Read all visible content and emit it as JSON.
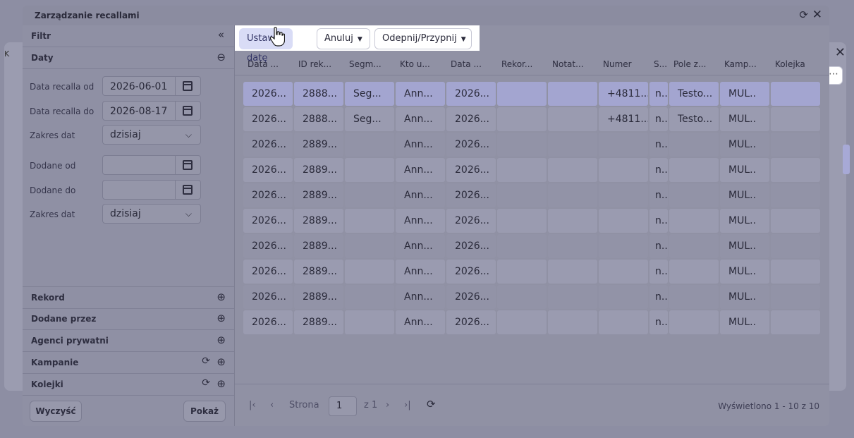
{
  "modal": {
    "title": "Zarządzanie recallami"
  },
  "filter": {
    "header": "Filtr",
    "section_dates": "Daty",
    "rows": {
      "recall_from_label": "Data recalla od",
      "recall_from_value": "2026-06-01",
      "recall_to_label": "Data recalla do",
      "recall_to_value": "2026-08-17",
      "range1_label": "Zakres dat",
      "range1_value": "dzisiaj",
      "added_from_label": "Dodane od",
      "added_from_value": "",
      "added_to_label": "Dodane do",
      "added_to_value": "",
      "range2_label": "Zakres dat",
      "range2_value": "dzisiaj"
    },
    "sections": [
      "Rekord",
      "Dodane przez",
      "Agenci prywatni",
      "Kampanie",
      "Kolejki"
    ],
    "clear_label": "Wyczyść",
    "show_label": "Pokaż"
  },
  "toolbar": {
    "set_date_label": "Ustaw datę",
    "cancel_label": "Anuluj",
    "pin_label": "Odepnij/Przypnij"
  },
  "grid": {
    "columns": [
      "Data ...",
      "ID rek...",
      "Segm...",
      "Kto u...",
      "Data ...",
      "Rekor...",
      "Notat...",
      "Numer",
      "S...",
      "Pole z...",
      "Kamp...",
      "Kolejka"
    ],
    "rows": [
      [
        "2026...",
        "2888...",
        "Seg...",
        "Ann...",
        "2026...",
        "",
        "",
        "+4811...",
        "n..",
        "Testo...",
        "MUL..",
        ""
      ],
      [
        "2026...",
        "2888...",
        "Seg...",
        "Ann...",
        "2026...",
        "",
        "",
        "+4811...",
        "n..",
        "Testo...",
        "MUL..",
        ""
      ],
      [
        "2026...",
        "2889...",
        "",
        "Ann...",
        "2026...",
        "",
        "",
        "",
        "n..",
        "",
        "MUL..",
        ""
      ],
      [
        "2026...",
        "2889...",
        "",
        "Ann...",
        "2026...",
        "",
        "",
        "",
        "n..",
        "",
        "MUL..",
        ""
      ],
      [
        "2026...",
        "2889...",
        "",
        "Ann...",
        "2026...",
        "",
        "",
        "",
        "n..",
        "",
        "MUL..",
        ""
      ],
      [
        "2026...",
        "2889...",
        "",
        "Ann...",
        "2026...",
        "",
        "",
        "",
        "n..",
        "",
        "MUL..",
        ""
      ],
      [
        "2026...",
        "2889...",
        "",
        "Ann...",
        "2026...",
        "",
        "",
        "",
        "n..",
        "",
        "MUL..",
        ""
      ],
      [
        "2026...",
        "2889...",
        "",
        "Ann...",
        "2026...",
        "",
        "",
        "",
        "n..",
        "",
        "MUL..",
        ""
      ],
      [
        "2026...",
        "2889...",
        "",
        "Ann...",
        "2026...",
        "",
        "",
        "",
        "n..",
        "",
        "MUL..",
        ""
      ],
      [
        "2026...",
        "2889...",
        "",
        "Ann...",
        "2026...",
        "",
        "",
        "",
        "n..",
        "",
        "MUL..",
        ""
      ]
    ]
  },
  "pager": {
    "page_label": "Strona",
    "page_value": "1",
    "of_label": "z 1",
    "info": "Wyświetlono 1 - 10 z 10"
  }
}
